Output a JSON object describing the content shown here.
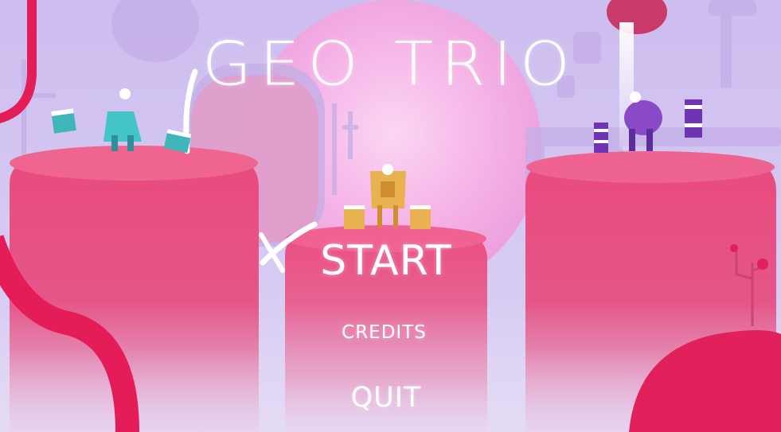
{
  "game": {
    "title": "GEO TRIO",
    "menu": {
      "start_label": "START",
      "credits_label": "CREDITS",
      "quit_label": "QUIT"
    }
  },
  "palette": {
    "sky": "#d6c6ef",
    "sun": "#f6b3e6",
    "pillar": "#e9497c",
    "pillar_top": "#f0638f",
    "teal": "#45c4c8",
    "gold": "#e7b24f",
    "purple": "#8a49c7",
    "ribbon": "#e41d59",
    "white": "#ffffff"
  },
  "characters": [
    {
      "name": "teal-character",
      "color": "teal"
    },
    {
      "name": "gold-character",
      "color": "gold"
    },
    {
      "name": "purple-character",
      "color": "purple"
    }
  ]
}
